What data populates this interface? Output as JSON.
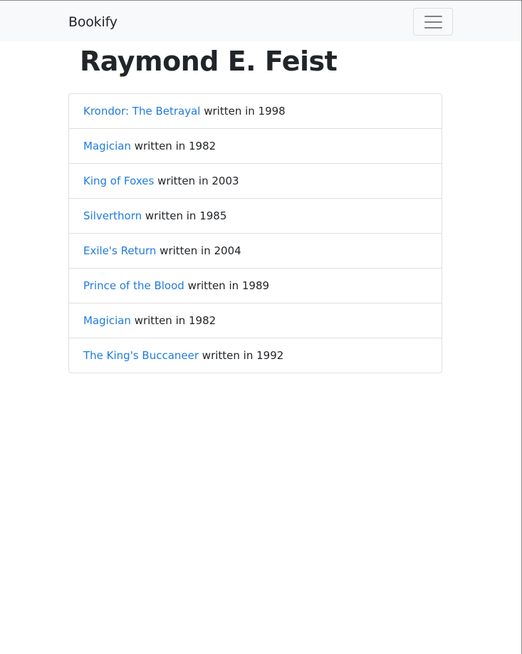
{
  "navbar": {
    "brand": "Bookify",
    "toggler_icon": "hamburger-icon"
  },
  "page": {
    "title": "Raymond E. Feist"
  },
  "books": [
    {
      "title": "Krondor: The Betrayal",
      "suffix": " written in 1998"
    },
    {
      "title": "Magician",
      "suffix": " written in 1982"
    },
    {
      "title": "King of Foxes",
      "suffix": " written in 2003"
    },
    {
      "title": "Silverthorn",
      "suffix": " written in 1985"
    },
    {
      "title": "Exile's Return",
      "suffix": " written in 2004"
    },
    {
      "title": "Prince of the Blood",
      "suffix": " written in 1989"
    },
    {
      "title": "Magician",
      "suffix": " written in 1982"
    },
    {
      "title": "The King's Buccaneer",
      "suffix": " written in 1992"
    }
  ],
  "colors": {
    "link": "#1f7bdc",
    "navbar_bg": "#f8f9fa",
    "text": "#212529",
    "border": "#dfdfdf"
  }
}
